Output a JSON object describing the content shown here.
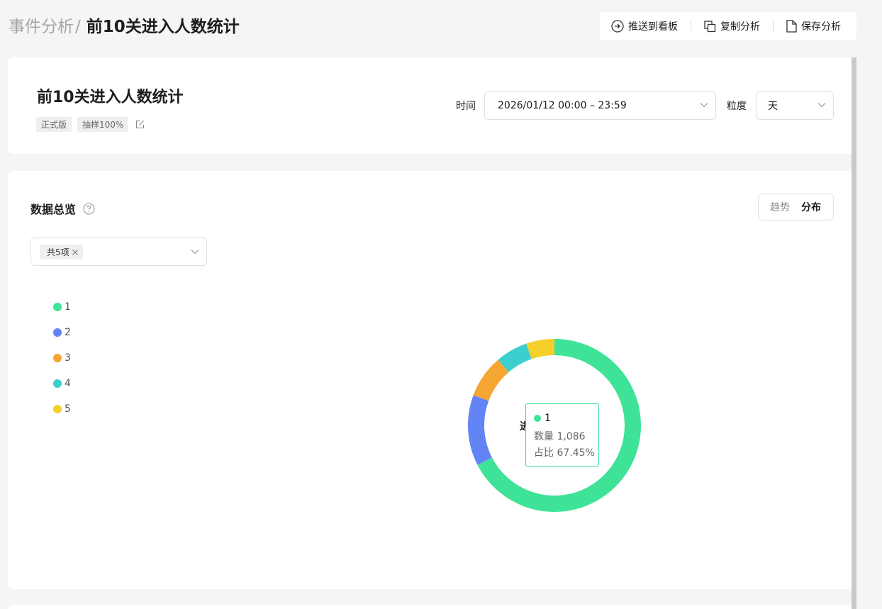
{
  "header": {
    "breadcrumb_parent": "事件分析",
    "breadcrumb_sep": "/",
    "breadcrumb_current": "前10关进入人数统计",
    "actions": [
      {
        "label": "推送到看板",
        "icon": "arrow-circle-right-icon"
      },
      {
        "label": "复制分析",
        "icon": "copy-icon"
      },
      {
        "label": "保存分析",
        "icon": "file-icon"
      }
    ]
  },
  "analysis": {
    "title": "前10关进入人数统计",
    "tags": [
      "正式版",
      "抽样100%"
    ],
    "time_label": "时间",
    "time_value": "2026/01/12 00:00 – 23:59",
    "granularity_label": "粒度",
    "granularity_value": "天"
  },
  "overview": {
    "title": "数据总览",
    "view_toggle": [
      "趋势",
      "分布"
    ],
    "active_view": "分布",
    "filter_chip": "共5项",
    "center_label_partial": "进",
    "tooltip": {
      "series": "1",
      "count_label": "数量",
      "count_value": "1,086",
      "ratio_label": "占比",
      "ratio_value": "67.45%"
    }
  },
  "chart_data": {
    "type": "pie",
    "donut": true,
    "categories": [
      "1",
      "2",
      "3",
      "4",
      "5"
    ],
    "values": [
      1086,
      213,
      129,
      97,
      85
    ],
    "colors": [
      "#3ee397",
      "#6284f5",
      "#f5a532",
      "#3ccfcf",
      "#f5cf2a"
    ],
    "legend_position": "left",
    "title": "",
    "xlabel": "",
    "ylabel": ""
  }
}
